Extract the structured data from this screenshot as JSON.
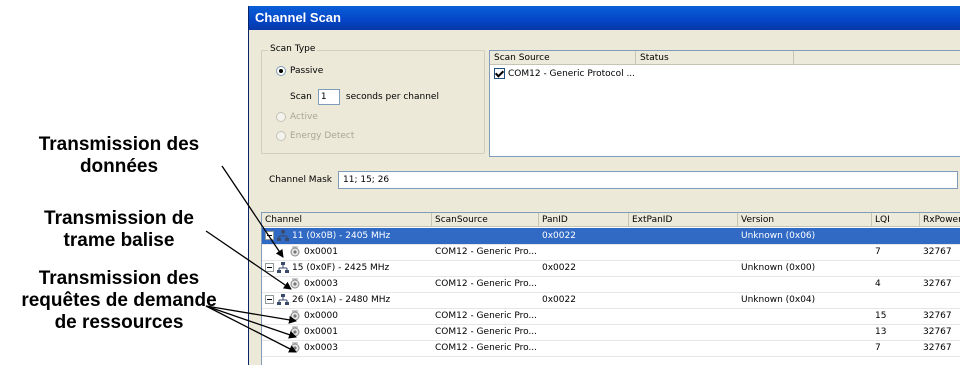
{
  "annotations": [
    {
      "lines": [
        "Transmission des",
        "données"
      ]
    },
    {
      "lines": [
        "Transmission de",
        "trame balise"
      ]
    },
    {
      "lines": [
        "Transmission des",
        "requêtes de demande",
        "de ressources"
      ]
    }
  ],
  "window": {
    "title": "Channel Scan"
  },
  "scan_type": {
    "legend": "Scan Type",
    "options": [
      {
        "label": "Passive",
        "selected": true,
        "enabled": true
      },
      {
        "label": "Active",
        "selected": false,
        "enabled": false
      },
      {
        "label": "Energy Detect",
        "selected": false,
        "enabled": false
      }
    ],
    "scan_label": "Scan",
    "scan_value": "1",
    "scan_unit": "seconds per channel"
  },
  "source_list": {
    "columns": [
      "Scan Source",
      "Status"
    ],
    "rows": [
      {
        "checked": true,
        "source": "COM12 - Generic Protocol ...",
        "status": ""
      }
    ]
  },
  "channel_mask": {
    "label": "Channel Mask",
    "value": "11; 15; 26"
  },
  "grid": {
    "columns": [
      "Channel",
      "ScanSource",
      "PanID",
      "ExtPanID",
      "Version",
      "LQI",
      "RxPower"
    ],
    "rows": [
      {
        "level": 0,
        "channel": "11 (0x0B) - 2405 MHz",
        "source": "",
        "panid": "0x0022",
        "extpanid": "",
        "version": "Unknown (0x06)",
        "lqi": "",
        "rxpower": "",
        "selected": true
      },
      {
        "level": 1,
        "channel": "0x0001",
        "source": "COM12 - Generic Pro...",
        "panid": "",
        "extpanid": "",
        "version": "",
        "lqi": "7",
        "rxpower": "32767",
        "selected": false
      },
      {
        "level": 0,
        "channel": "15 (0x0F) - 2425 MHz",
        "source": "",
        "panid": "0x0022",
        "extpanid": "",
        "version": "Unknown (0x00)",
        "lqi": "",
        "rxpower": "",
        "selected": false
      },
      {
        "level": 1,
        "channel": "0x0003",
        "source": "COM12 - Generic Pro...",
        "panid": "",
        "extpanid": "",
        "version": "",
        "lqi": "4",
        "rxpower": "32767",
        "selected": false
      },
      {
        "level": 0,
        "channel": "26 (0x1A) - 2480 MHz",
        "source": "",
        "panid": "0x0022",
        "extpanid": "",
        "version": "Unknown (0x04)",
        "lqi": "",
        "rxpower": "",
        "selected": false
      },
      {
        "level": 1,
        "channel": "0x0000",
        "source": "COM12 - Generic Pro...",
        "panid": "",
        "extpanid": "",
        "version": "",
        "lqi": "15",
        "rxpower": "32767",
        "selected": false
      },
      {
        "level": 1,
        "channel": "0x0001",
        "source": "COM12 - Generic Pro...",
        "panid": "",
        "extpanid": "",
        "version": "",
        "lqi": "13",
        "rxpower": "32767",
        "selected": false
      },
      {
        "level": 1,
        "channel": "0x0003",
        "source": "COM12 - Generic Pro...",
        "panid": "",
        "extpanid": "",
        "version": "",
        "lqi": "7",
        "rxpower": "32767",
        "selected": false
      }
    ]
  },
  "colors": {
    "selection": "#316ac5",
    "title_bar": "#0445c6",
    "window_bg": "#ece9d8"
  }
}
